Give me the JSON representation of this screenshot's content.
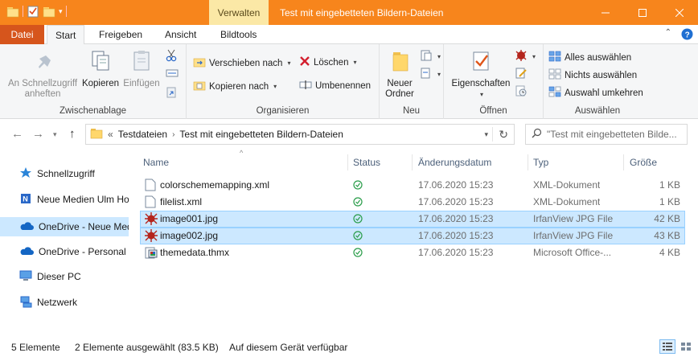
{
  "window": {
    "title": "Test mit eingebetteten Bildern-Dateien",
    "context_tab": "Verwalten",
    "accent_color": "#f7851c"
  },
  "tabs": {
    "file": "Datei",
    "items": [
      "Start",
      "Freigeben",
      "Ansicht",
      "Bildtools"
    ]
  },
  "ribbon": {
    "clipboard": {
      "label": "Zwischenablage",
      "pin": "An Schnellzugriff anheften",
      "copy": "Kopieren",
      "paste": "Einfügen"
    },
    "organize": {
      "label": "Organisieren",
      "move_to": "Verschieben nach",
      "copy_to": "Kopieren nach",
      "delete": "Löschen",
      "rename": "Umbenennen"
    },
    "new": {
      "label": "Neu",
      "new_folder": "Neuer Ordner"
    },
    "open": {
      "label": "Öffnen",
      "properties": "Eigenschaften"
    },
    "select": {
      "label": "Auswählen",
      "select_all": "Alles auswählen",
      "select_none": "Nichts auswählen",
      "invert": "Auswahl umkehren"
    }
  },
  "address": {
    "prefix": "«",
    "crumbs": [
      "Testdateien",
      "Test mit eingebetteten Bildern-Dateien"
    ],
    "search_placeholder": "\"Test mit eingebetteten Bilde..."
  },
  "navpane": {
    "items": [
      {
        "label": "Schnellzugriff",
        "icon": "star-icon"
      },
      {
        "label": "Neue Medien Ulm Ho",
        "icon": "people-icon"
      },
      {
        "label": "OneDrive - Neue Med",
        "icon": "cloud-icon"
      },
      {
        "label": "OneDrive - Personal",
        "icon": "cloud-icon"
      },
      {
        "label": "Dieser PC",
        "icon": "computer-icon"
      },
      {
        "label": "Netzwerk",
        "icon": "network-icon"
      }
    ]
  },
  "filelist": {
    "columns": {
      "name": "Name",
      "status": "Status",
      "date": "Änderungsdatum",
      "type": "Typ",
      "size": "Größe"
    },
    "files": [
      {
        "name": "colorschememapping.xml",
        "date": "17.06.2020 15:23",
        "type": "XML-Dokument",
        "size": "1 KB",
        "icon": "document-icon"
      },
      {
        "name": "filelist.xml",
        "date": "17.06.2020 15:23",
        "type": "XML-Dokument",
        "size": "1 KB",
        "icon": "document-icon"
      },
      {
        "name": "image001.jpg",
        "date": "17.06.2020 15:23",
        "type": "IrfanView JPG File",
        "size": "42 KB",
        "icon": "irfanview-icon"
      },
      {
        "name": "image002.jpg",
        "date": "17.06.2020 15:23",
        "type": "IrfanView JPG File",
        "size": "43 KB",
        "icon": "irfanview-icon"
      },
      {
        "name": "themedata.thmx",
        "date": "17.06.2020 15:23",
        "type": "Microsoft Office-...",
        "size": "4 KB",
        "icon": "theme-file-icon"
      }
    ]
  },
  "statusbar": {
    "count": "5 Elemente",
    "selection": "2 Elemente ausgewählt (83.5 KB)",
    "availability": "Auf diesem Gerät verfügbar"
  }
}
